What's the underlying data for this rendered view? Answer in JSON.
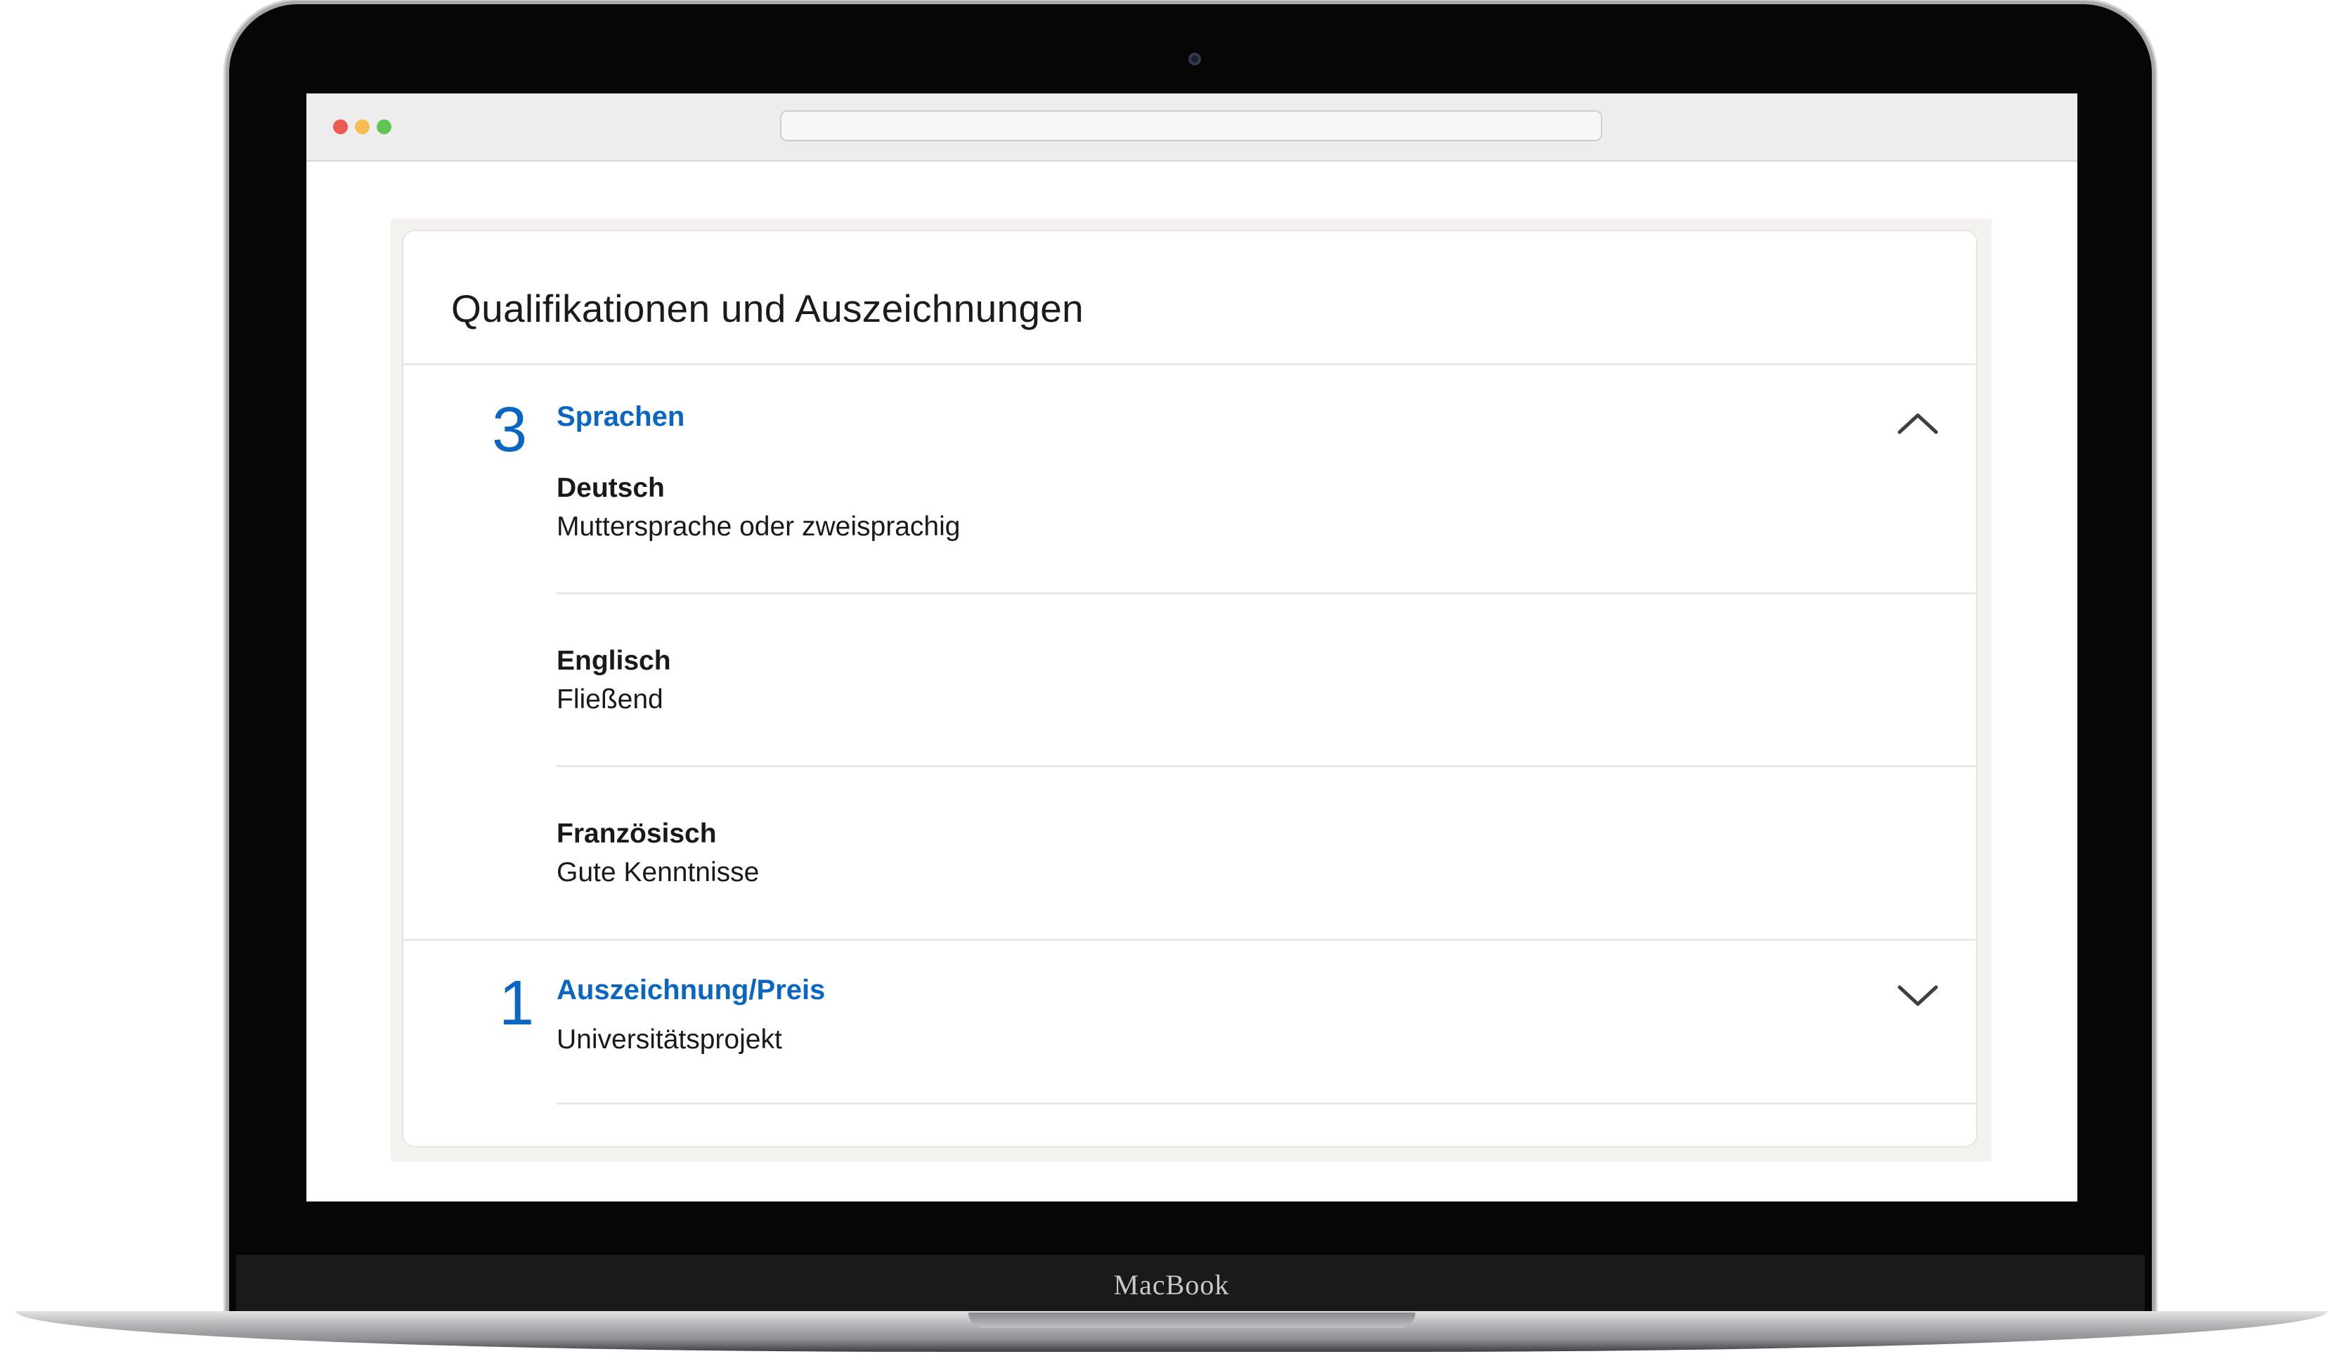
{
  "device": {
    "brand_label": "MacBook"
  },
  "card": {
    "title": "Qualifikationen und Auszeichnungen",
    "sections": [
      {
        "count": "3",
        "title": "Sprachen",
        "expanded": true,
        "toggle_icon": "chevron-up-icon",
        "items": [
          {
            "title": "Deutsch",
            "subtitle": "Muttersprache oder zweisprachig"
          },
          {
            "title": "Englisch",
            "subtitle": "Fließend"
          },
          {
            "title": "Französisch",
            "subtitle": "Gute Kenntnisse"
          }
        ]
      },
      {
        "count": "1",
        "title": "Auszeichnung/Preis",
        "expanded": false,
        "toggle_icon": "chevron-down-icon",
        "items": [
          {
            "title": "Universitätsprojekt"
          }
        ]
      }
    ]
  },
  "colors": {
    "accent": "#0a66c2",
    "page_background": "#f3f2ef",
    "text": "#191919"
  }
}
